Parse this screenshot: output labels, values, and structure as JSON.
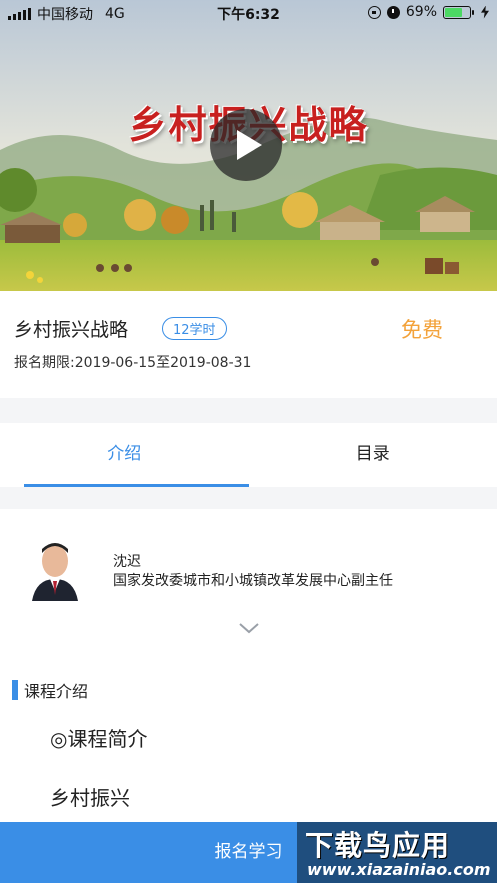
{
  "status_bar": {
    "carrier": "中国移动",
    "network": "4G",
    "time": "下午6:32",
    "battery": "69%",
    "battery_level": 0.69
  },
  "banner": {
    "title": "乡村振兴战略"
  },
  "course": {
    "title": "乡村振兴战略",
    "hours": "12学时",
    "price": "免费",
    "period": "报名期限:2019-06-15至2019-08-31"
  },
  "tabs": [
    {
      "label": "介绍",
      "active": true
    },
    {
      "label": "目录",
      "active": false
    }
  ],
  "lecturer": {
    "name": "沈迟",
    "title": "国家发改委城市和小城镇改革发展中心副主任"
  },
  "section": {
    "heading": "课程介绍",
    "intro_heading": "◎课程简介",
    "intro_text": "乡村振兴"
  },
  "bottom": {
    "enroll_label": "报名学习"
  },
  "watermark": {
    "main": "下载鸟应用",
    "url": "www.xiazainiao.com"
  },
  "colors": {
    "accent": "#3a8ee6",
    "price": "#f3a23a",
    "title_red": "#c8201f"
  }
}
